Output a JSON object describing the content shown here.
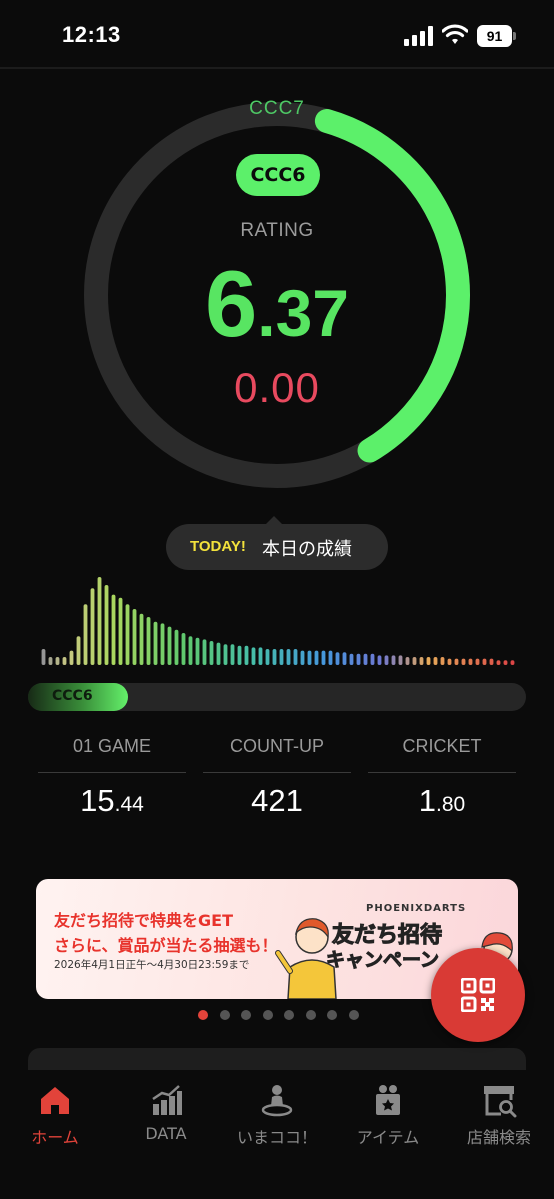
{
  "status_bar": {
    "time": "12:13",
    "battery": "91"
  },
  "rating": {
    "next_class": "CCC7",
    "current_class": "CCC6",
    "label": "RATING",
    "value_int": "6",
    "value_dec": ".37",
    "value": 6.37,
    "today_value": "0.00",
    "progress_to_next": 0.37
  },
  "today": {
    "tag": "TODAY!",
    "text": "本日の成績"
  },
  "class_progress": {
    "label": "CCC6",
    "fraction": 0.2
  },
  "history_bars": [
    10,
    5,
    5,
    5,
    9,
    18,
    38,
    48,
    55,
    50,
    44,
    42,
    38,
    35,
    32,
    30,
    27,
    26,
    24,
    22,
    20,
    18,
    17,
    16,
    15,
    14,
    13,
    13,
    12,
    12,
    11,
    11,
    10,
    10,
    10,
    10,
    10,
    9,
    9,
    9,
    9,
    9,
    8,
    8,
    7,
    7,
    7,
    7,
    6,
    6,
    6,
    6,
    5,
    5,
    5,
    5,
    5,
    5,
    4,
    4,
    4,
    4,
    4,
    4,
    4,
    3,
    3,
    3
  ],
  "stats": [
    {
      "label": "01 GAME",
      "int": "15",
      "dec": ".44"
    },
    {
      "label": "COUNT-UP",
      "int": "421",
      "dec": ""
    },
    {
      "label": "CRICKET",
      "int": "1",
      "dec": ".80"
    }
  ],
  "banner": {
    "line1": "友だち招待で特典をGET",
    "line2": "さらに、賞品が当たる抽選も！",
    "line3": "2026年4月1日正午〜4月30日23:59まで",
    "brand": "PHOENIXDARTS",
    "title1": "友だち招待",
    "title2": "キャンペーン"
  },
  "carousel": {
    "count": 8,
    "active": 0
  },
  "tabs": [
    {
      "label": "ホーム",
      "icon": "home-icon"
    },
    {
      "label": "DATA",
      "icon": "chart-icon"
    },
    {
      "label": "いまココ！",
      "icon": "location-person-icon"
    },
    {
      "label": "アイテム",
      "icon": "item-bag-icon"
    },
    {
      "label": "店舗検索",
      "icon": "shop-search-icon"
    }
  ],
  "colors": {
    "accent_green": "#5cf06a",
    "accent_red": "#e2433a",
    "today_value": "#e84a5f",
    "today_tag": "#f3e23c"
  }
}
